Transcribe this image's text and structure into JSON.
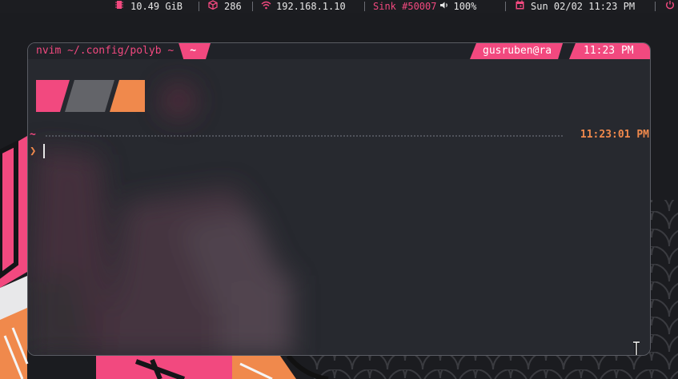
{
  "colors": {
    "accent_pink": "#f2497f",
    "accent_orange": "#f0894c",
    "block_gray": "#636469",
    "terminal_bg": "#27292f",
    "bar_bg": "#1c1d21"
  },
  "polybar": {
    "memory": {
      "icon": "memory-chip-icon",
      "text": "10.49 GiB"
    },
    "packages": {
      "icon": "package-cube-icon",
      "text": "286"
    },
    "network": {
      "icon": "wifi-icon",
      "text": "192.168.1.10"
    },
    "audio": {
      "sink_text": "Sink #50007",
      "icon": "speaker-icon",
      "volume": "100%"
    },
    "date": {
      "icon": "calendar-icon",
      "text": "Sun 02/02 11:23 PM"
    },
    "power": {
      "icon": "power-icon"
    }
  },
  "terminal": {
    "window_label": "nvim ~/.config/polyb ~",
    "active_tab": "~",
    "user_host": "gusruben@ra",
    "clock": "11:23 PM",
    "prompt_dir": "~",
    "prompt_time": "11:23:01 PM",
    "prompt_symbol": "❯"
  }
}
